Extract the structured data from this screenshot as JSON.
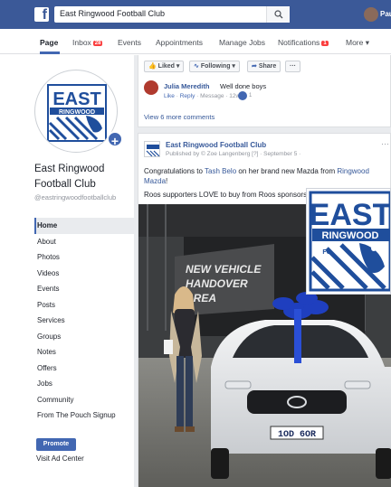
{
  "topbar": {
    "brand_icon": "facebook-icon",
    "search_value": "East Ringwood Football Club",
    "search_icon": "search-icon",
    "user_name": "Paul",
    "brand_color": "#3b5998"
  },
  "nav": {
    "page": "Page",
    "inbox": "Inbox",
    "inbox_badge": "28",
    "events": "Events",
    "appointments": "Appointments",
    "manage_jobs": "Manage Jobs",
    "notifications": "Notifications",
    "notifications_badge": "1",
    "more": "More ▾"
  },
  "sidebar": {
    "page_name": "East Ringwood Football Club",
    "handle": "@eastringwoodfootballclub",
    "items": [
      {
        "label": "Home"
      },
      {
        "label": "About"
      },
      {
        "label": "Photos"
      },
      {
        "label": "Videos"
      },
      {
        "label": "Events"
      },
      {
        "label": "Posts"
      },
      {
        "label": "Services"
      },
      {
        "label": "Groups"
      },
      {
        "label": "Notes"
      },
      {
        "label": "Offers"
      },
      {
        "label": "Jobs"
      },
      {
        "label": "Community"
      },
      {
        "label": "From The Pouch Signup"
      }
    ],
    "promote": "Promote",
    "visit_ad_center": "Visit Ad Center"
  },
  "logo": {
    "line1": "EAST",
    "line2": "RINGWOOD",
    "fc": "FC",
    "accent": "#1f4e9c"
  },
  "top_card": {
    "liked": "Liked ▾",
    "following": "Following ▾",
    "share": "Share",
    "more": "···",
    "comment_author": "Julia Meredith",
    "comment_text": "Well done boys",
    "comment_meta_like": "Like",
    "comment_meta_reply": "Reply",
    "comment_meta_message": "Message",
    "comment_meta_time": "12w",
    "comment_like_count": "1",
    "view_more": "View 6 more comments"
  },
  "post": {
    "author": "East Ringwood Football Club",
    "meta": "Published by © Zoe Langenberg [?] · September 5 ·",
    "text_before": "Congratulations to ",
    "text_link1": "Tash Belo",
    "text_middle": " on her brand new Mazda from ",
    "text_link2": "Ringwood Mazda",
    "text_after": "!",
    "text2": "Roos supporters LOVE to buy from Roos sponsors.",
    "photo_sign1": "NEW VEHICLE",
    "photo_sign2": "HANDOVER",
    "photo_sign3": "AREA",
    "plate": "1OD 6OR"
  }
}
